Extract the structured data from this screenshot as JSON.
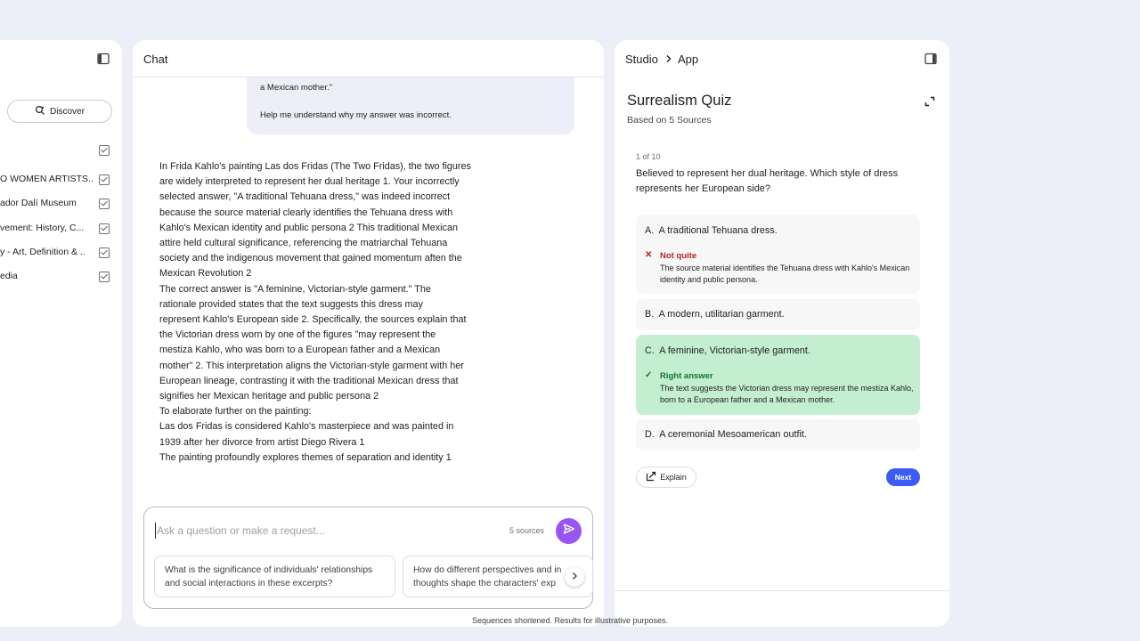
{
  "sources_panel": {
    "discover_label": "Discover",
    "items": [
      {
        "label": "O WOMEN ARTISTS..",
        "checked": true
      },
      {
        "label": "ador Dalí Museum",
        "checked": true
      },
      {
        "label": "vement: History, C...",
        "checked": true
      },
      {
        "label": "y - Art, Definition & ..",
        "checked": true
      },
      {
        "label": "edia",
        "checked": true
      }
    ]
  },
  "chat": {
    "title": "Chat",
    "user_message_line1": "a Mexican mother.\"",
    "user_message_line2": "Help me understand why my answer was incorrect.",
    "answer_lines": [
      "In Frida Kahlo's painting Las dos Fridas (The Two Fridas), the two figures",
      "are widely interpreted to represent her dual heritage 1. Your incorrectly",
      "selected answer, \"A traditional Tehuana dress,\" was indeed incorrect",
      "because the source material clearly identifies the Tehuana dress with",
      "Kahlo's Mexican identity and public persona 2 This traditional Mexican",
      "attire held cultural significance, referencing the matriarchal Tehuana",
      "society and the indigenous movement that gained momentum aften the",
      "Mexican Revolution 2",
      "The correct answer is \"A feminine, Victorian-style garment.\" The",
      "rationale provided states that the text suggests this dress may",
      "represent Kahlo's European side 2. Specifically, the sources explain that",
      "the Victorian dress worn by one of the figures \"may represent the",
      "mestiza Kahlo, who was born to a European father and a Mexican",
      "mother\" 2. This interpretation aligns the Victorian-style garment with her",
      "European lineage, contrasting it with the traditional Mexican dress that",
      "signifies her Mexican heritage and public persona 2",
      "To elaborate further on the painting:",
      "Las dos Fridas is considered Kahlo's masterpiece and was painted in",
      "1939 after her divorce from artist Diego Rivera 1",
      "The painting profoundly explores themes of separation and identity 1"
    ],
    "input_placeholder": "Ask a question or make a request...",
    "sources_count": "5 sources",
    "suggestions": [
      "What is the significance of individuals' relationships\nand social interactions in these excerpts?",
      "How do different perspectives and in\nthoughts shape the characters' exp"
    ]
  },
  "studio": {
    "crumb_studio": "Studio",
    "crumb_sep": ">",
    "crumb_app": "App",
    "quiz_title": "Surrealism Quiz",
    "quiz_subtitle": "Based on 5 Sources",
    "question_counter": "1 of 10",
    "question": "Believed to represent her dual heritage. Which style of dress represents her European side?",
    "options": [
      {
        "letter": "A.",
        "text": "A traditional Tehuana dress.",
        "state": "incorrect",
        "feedback_title": "Not quite",
        "feedback_body": "The source material identifies the Tehuana dress with Kahlo's Mexican identity and public persona."
      },
      {
        "letter": "B.",
        "text": "A modern, utilitarian garment.",
        "state": "none"
      },
      {
        "letter": "C.",
        "text": "A feminine, Victorian-style garment.",
        "state": "correct",
        "feedback_title": "Right answer",
        "feedback_body": "The text suggests the Victorian dress may represent the mestiza Kahlo, born to a European father and a Mexican mother."
      },
      {
        "letter": "D.",
        "text": "A ceremonial Mesoamerican outfit.",
        "state": "none"
      }
    ],
    "explain_label": "Explain",
    "next_label": "Next"
  },
  "colors": {
    "background": "#eceef8",
    "send_button": "#9a54f2",
    "correct_bg": "#c4eed0",
    "correct_text": "#137333",
    "incorrect_text": "#b3261e",
    "next_button": "#3d5bf5"
  },
  "footer": {
    "disclaimer": "Sequences shortened. Results for illustrative purposes."
  }
}
